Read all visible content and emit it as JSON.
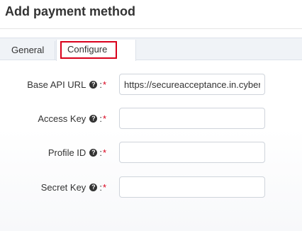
{
  "header": {
    "title": "Add payment method"
  },
  "tabs": [
    {
      "label": "General",
      "active": false
    },
    {
      "label": "Configure",
      "active": true
    }
  ],
  "form": {
    "fields": [
      {
        "label": "Base API URL",
        "help_icon": "question-circle-icon",
        "suffix": ":",
        "required_mark": "*",
        "value": "https://secureacceptance.in.cyber",
        "placeholder": ""
      },
      {
        "label": "Access Key",
        "help_icon": "question-circle-icon",
        "suffix": ":",
        "required_mark": "*",
        "value": "",
        "placeholder": ""
      },
      {
        "label": "Profile ID",
        "help_icon": "question-circle-icon",
        "suffix": ":",
        "required_mark": "*",
        "value": "",
        "placeholder": ""
      },
      {
        "label": "Secret Key",
        "help_icon": "question-circle-icon",
        "suffix": ":",
        "required_mark": "*",
        "value": "",
        "placeholder": ""
      }
    ]
  },
  "colors": {
    "required": "#d9001b",
    "active_tab_outline": "#d9001b",
    "text": "#333333"
  }
}
